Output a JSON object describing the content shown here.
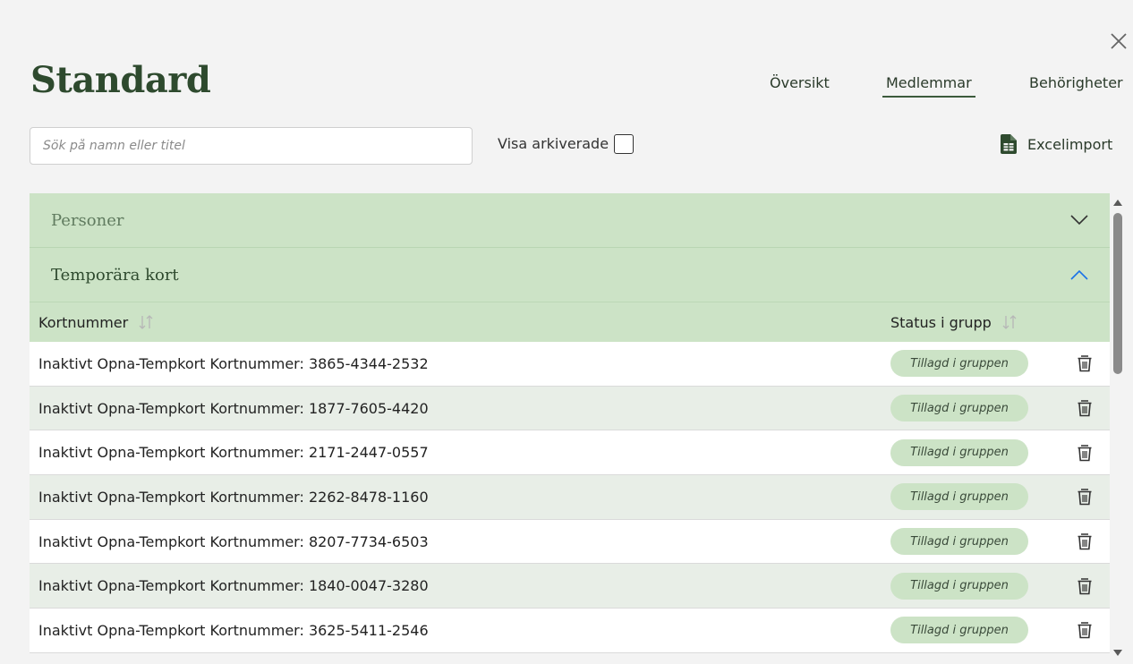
{
  "dialog": {
    "title": "Standard",
    "close_icon": "close-icon"
  },
  "nav": {
    "tabs": [
      {
        "label": "Översikt",
        "active": false
      },
      {
        "label": "Medlemmar",
        "active": true
      },
      {
        "label": "Behörigheter",
        "active": false
      }
    ]
  },
  "toolbar": {
    "search_placeholder": "Sök på namn eller titel",
    "search_value": "",
    "show_archived_label": "Visa arkiverade",
    "show_archived_checked": false,
    "excel_import_label": "Excelimport",
    "excel_icon": "spreadsheet-file-icon"
  },
  "sections": {
    "persons": {
      "title": "Personer",
      "expanded": false
    },
    "temp_cards": {
      "title": "Temporära kort",
      "expanded": true
    }
  },
  "table": {
    "columns": {
      "card_number": "Kortnummer",
      "status": "Status i grupp"
    },
    "rows": [
      {
        "name": "Inaktivt Opna-Tempkort Kortnummer: 3865-4344-2532",
        "status": "Tillagd i gruppen"
      },
      {
        "name": "Inaktivt Opna-Tempkort Kortnummer: 1877-7605-4420",
        "status": "Tillagd i gruppen"
      },
      {
        "name": "Inaktivt Opna-Tempkort Kortnummer: 2171-2447-0557",
        "status": "Tillagd i gruppen"
      },
      {
        "name": "Inaktivt Opna-Tempkort Kortnummer: 2262-8478-1160",
        "status": "Tillagd i gruppen"
      },
      {
        "name": "Inaktivt Opna-Tempkort Kortnummer: 8207-7734-6503",
        "status": "Tillagd i gruppen"
      },
      {
        "name": "Inaktivt Opna-Tempkort Kortnummer: 1840-0047-3280",
        "status": "Tillagd i gruppen"
      },
      {
        "name": "Inaktivt Opna-Tempkort Kortnummer: 3625-5411-2546",
        "status": "Tillagd i gruppen"
      }
    ]
  },
  "colors": {
    "accent_green": "#cce3c6",
    "title_green": "#2e4a2e",
    "alt_row": "#e8eee7",
    "chevron_up_blue": "#1a73e8"
  }
}
